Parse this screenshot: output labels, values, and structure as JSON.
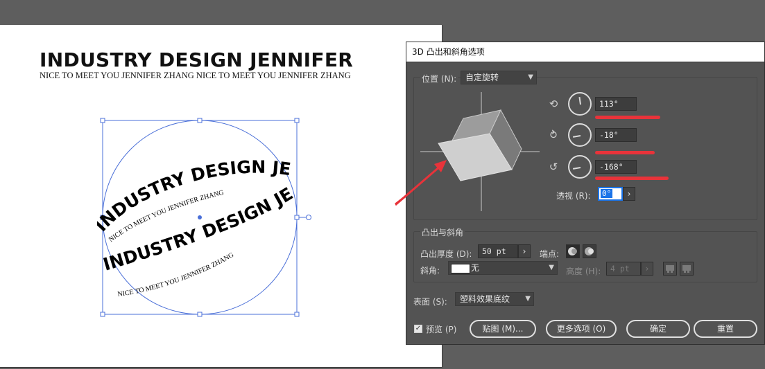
{
  "artboard": {
    "title": "INDUSTRY DESIGN JENNIFER",
    "subtitle": "NICE TO MEET YOU JENNIFER ZHANG  NICE TO MEET YOU JENNIFER ZHANG",
    "band_title": "INDUSTRY DESIGN JENNIFER",
    "band_subtitle": "NICE TO MEET YOU JENNIFER ZHANG",
    "band_full": "INDUSTRY DESIGN JENNIFER NICE TO MEET YOU JENNIFER ZHANG NICE TO MEET YOU JENNIFER ZHANG"
  },
  "dialog": {
    "title": "3D 凸出和斜角选项",
    "position": {
      "label": "位置 (N):",
      "value": "自定旋转",
      "x_rotation": "113°",
      "y_rotation": "-18°",
      "z_rotation": "-168°",
      "perspective_label": "透视 (R):",
      "perspective_value": "0°"
    },
    "extrude": {
      "group_label": "凸出与斜角",
      "depth_label": "凸出厚度 (D):",
      "depth_value": "50 pt",
      "cap_label": "端点:",
      "bevel_label": "斜角:",
      "bevel_value": "无",
      "height_label": "高度 (H):",
      "height_value": "4 pt"
    },
    "surface": {
      "label": "表面 (S):",
      "value": "塑料效果底纹"
    },
    "preview_label": "预览 (P)",
    "map_button": "贴图 (M)...",
    "more_button": "更多选项 (O)",
    "ok_button": "确定",
    "reset_button": "重置"
  },
  "colors": {
    "annotation_red": "#e8333a",
    "selection_blue": "#4a6fd8"
  }
}
